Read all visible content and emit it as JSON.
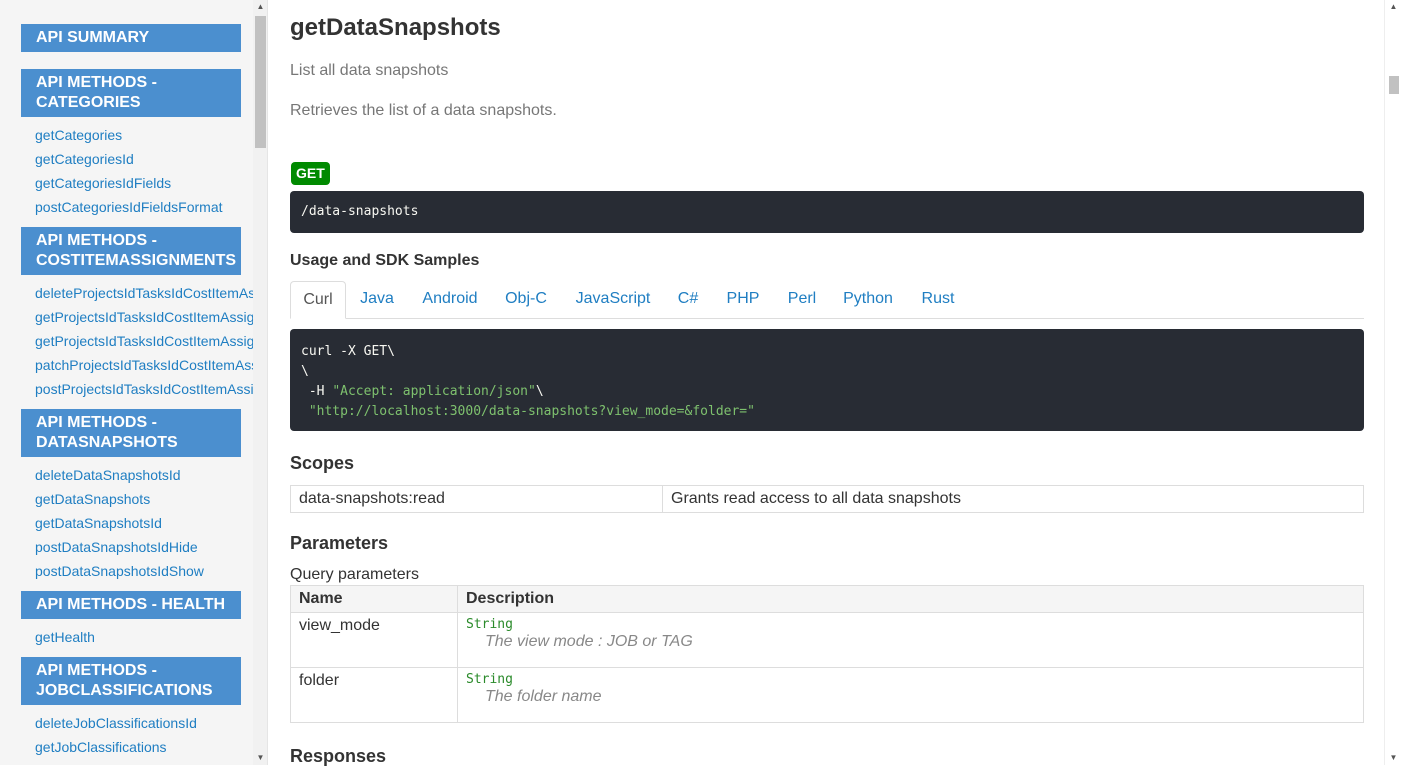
{
  "sidebar": {
    "sections": [
      {
        "header": "API SUMMARY",
        "items": []
      },
      {
        "header": "API METHODS - CATEGORIES",
        "items": [
          "getCategories",
          "getCategoriesId",
          "getCategoriesIdFields",
          "postCategoriesIdFieldsFormat"
        ]
      },
      {
        "header": "API METHODS - COSTITEMASSIGNMENTS",
        "items": [
          "deleteProjectsIdTasksIdCostItemAssignmentsId",
          "getProjectsIdTasksIdCostItemAssignments",
          "getProjectsIdTasksIdCostItemAssignmentsId",
          "patchProjectsIdTasksIdCostItemAssignmentsId",
          "postProjectsIdTasksIdCostItemAssignments"
        ]
      },
      {
        "header": "API METHODS - DATASNAPSHOTS",
        "items": [
          "deleteDataSnapshotsId",
          "getDataSnapshots",
          "getDataSnapshotsId",
          "postDataSnapshotsIdHide",
          "postDataSnapshotsIdShow"
        ]
      },
      {
        "header": "API METHODS - HEALTH",
        "items": [
          "getHealth"
        ]
      },
      {
        "header": "API METHODS - JOBCLASSIFICATIONS",
        "items": [
          "deleteJobClassificationsId",
          "getJobClassifications"
        ]
      }
    ]
  },
  "main": {
    "title": "getDataSnapshots",
    "summary": "List all data snapshots",
    "description": "Retrieves the list of a data snapshots.",
    "method": "GET",
    "path": "/data-snapshots",
    "usage_heading": "Usage and SDK Samples",
    "tabs": [
      "Curl",
      "Java",
      "Android",
      "Obj-C",
      "JavaScript",
      "C#",
      "PHP",
      "Perl",
      "Python",
      "Rust"
    ],
    "active_tab": "Curl",
    "code": {
      "line1": "curl -X GET\\",
      "line2": "\\",
      "line3_prefix": " -H ",
      "line3_str": "\"Accept: application/json\"",
      "line3_suffix": "\\",
      "line4_prefix": " ",
      "line4_str": "\"http://localhost:3000/data-snapshots?view_mode=&folder=\""
    },
    "scopes_heading": "Scopes",
    "scopes": [
      {
        "scope": "data-snapshots:read",
        "description": "Grants read access to all data snapshots"
      }
    ],
    "parameters_heading": "Parameters",
    "query_label": "Query parameters",
    "param_headers": {
      "name": "Name",
      "description": "Description"
    },
    "params": [
      {
        "name": "view_mode",
        "type": "String",
        "description": "The view mode : JOB or TAG"
      },
      {
        "name": "folder",
        "type": "String",
        "description": "The folder name"
      }
    ],
    "responses_heading": "Responses"
  },
  "colors": {
    "nav_header": "#4b8fcf",
    "link": "#1f7ec2",
    "get_badge": "#008a00",
    "code_bg": "#282c34",
    "code_string": "#7ec16e"
  }
}
